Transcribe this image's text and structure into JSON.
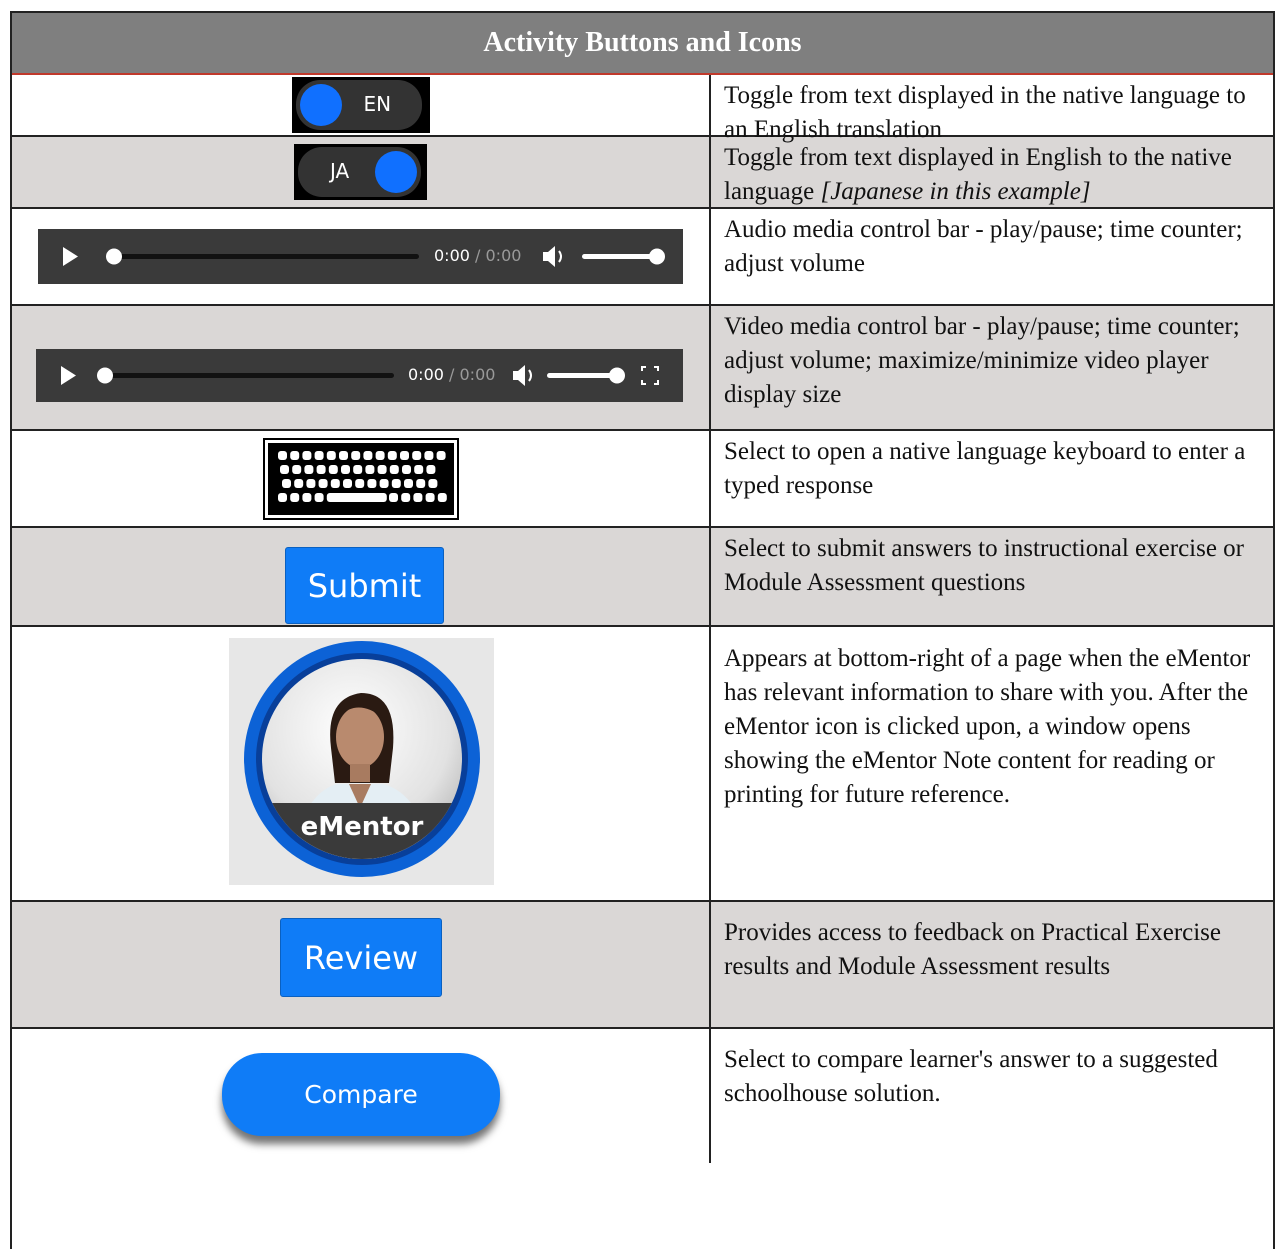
{
  "title": "Activity Buttons and Icons",
  "rows": [
    {
      "visual": {
        "toggle_label": "EN"
      },
      "description": "Toggle from text displayed in the native language to an English translation"
    },
    {
      "visual": {
        "toggle_label": "JA"
      },
      "description_main": "Toggle from text displayed in English to the native language ",
      "description_italic": "[Japanese in this example]"
    },
    {
      "visual": {
        "time_current": "0:00",
        "time_sep": " / ",
        "time_total": "0:00"
      },
      "description": "Audio media control bar - play/pause; time counter; adjust volume"
    },
    {
      "visual": {
        "time_current": "0:00",
        "time_sep": " / ",
        "time_total": "0:00"
      },
      "description": "Video media control bar - play/pause; time counter; adjust volume; maximize/minimize video player display size"
    },
    {
      "visual": {
        "icon": "keyboard-icon"
      },
      "description": "Select to open a native language keyboard to enter a typed response"
    },
    {
      "visual": {
        "button_label": "Submit"
      },
      "description": "Select to submit answers to instructional exercise or Module Assessment questions"
    },
    {
      "visual": {
        "badge_label": "eMentor"
      },
      "description": "Appears at bottom-right of a page when the eMentor has relevant information to share with you. After the eMentor icon is clicked upon, a window opens showing the eMentor Note content for reading or printing for future reference."
    },
    {
      "visual": {
        "button_label": "Review"
      },
      "description": "Provides access to feedback on Practical Exercise results and Module Assessment results"
    },
    {
      "visual": {
        "button_label": "Compare"
      },
      "description": "Select to compare learner's answer to a suggested schoolhouse solution."
    }
  ],
  "colors": {
    "header_bg": "#7f7f7f",
    "header_rule": "#c0392b",
    "row_shade": "#dad7d6",
    "accent_blue": "#0f7cf7"
  }
}
